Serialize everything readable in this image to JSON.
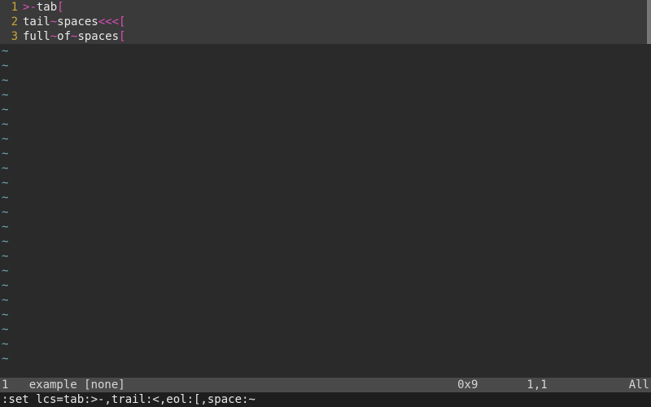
{
  "buffer": {
    "lines": [
      {
        "num": "1",
        "segments": [
          {
            "t": ">-",
            "lc": true
          },
          {
            "t": "tab",
            "lc": false
          },
          {
            "t": "[",
            "lc": true
          }
        ]
      },
      {
        "num": "2",
        "segments": [
          {
            "t": "tail",
            "lc": false
          },
          {
            "t": "~",
            "lc": true
          },
          {
            "t": "spaces",
            "lc": false
          },
          {
            "t": "<<<[",
            "lc": true
          }
        ]
      },
      {
        "num": "3",
        "segments": [
          {
            "t": "full",
            "lc": false
          },
          {
            "t": "~",
            "lc": true
          },
          {
            "t": "of",
            "lc": false
          },
          {
            "t": "~",
            "lc": true
          },
          {
            "t": "spaces",
            "lc": false
          },
          {
            "t": "[",
            "lc": true
          }
        ]
      }
    ],
    "empty_marker": "~",
    "empty_rows": 22
  },
  "statusline": {
    "left": "1   example [none]",
    "char_under_cursor": "0x9",
    "cursor_pos": "1,1",
    "percent": "All"
  },
  "cmdline": ":set lcs=tab:>-,trail:<,eol:[,space:~",
  "listchars": {
    "tab": ">-",
    "trail": "<",
    "eol": "[",
    "space": "~"
  }
}
